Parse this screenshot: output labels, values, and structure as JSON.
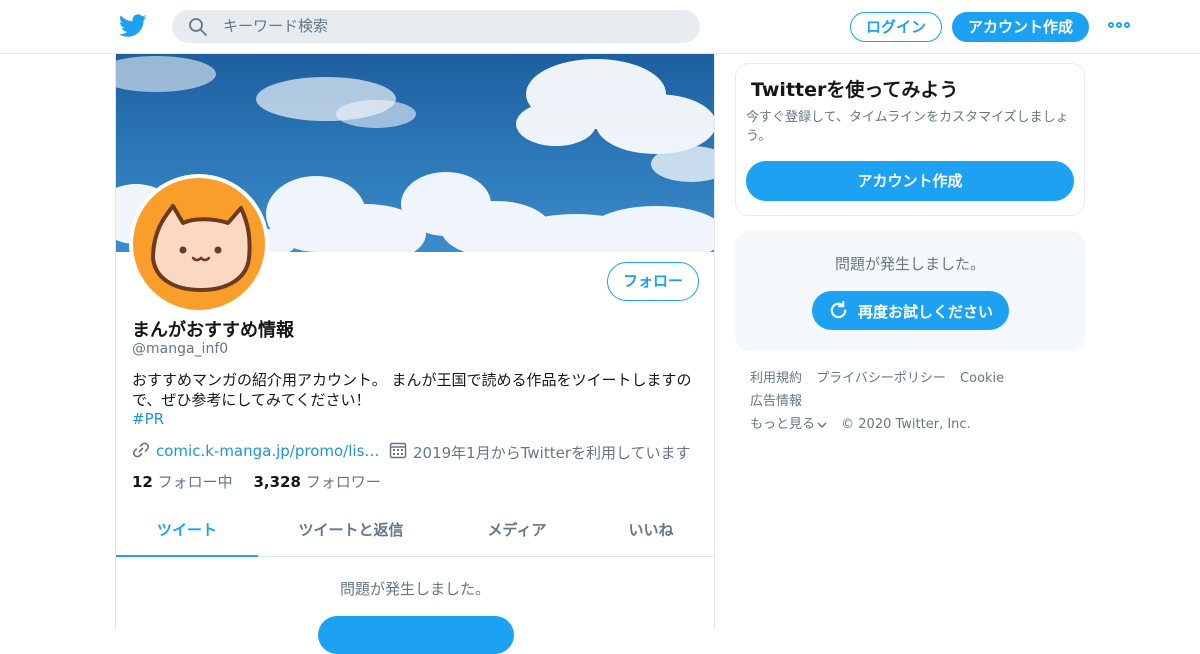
{
  "topbar": {
    "search_placeholder": "キーワード検索",
    "login_label": "ログイン",
    "signup_label": "アカウント作成"
  },
  "profile": {
    "name": "まんがおすすめ情報",
    "handle": "@manga_inf0",
    "follow_label": "フォロー",
    "bio": "おすすめマンガの紹介用アカウント。 まんが王国で読める作品をツイートしますので、ぜひ参考にしてみてください！",
    "hashtag": "#PR",
    "url": "comic.k-manga.jp/promo/listing/…",
    "joined": "2019年1月からTwitterを利用しています",
    "following_count": "12",
    "following_label": "フォロー中",
    "followers_count": "3,328",
    "followers_label": "フォロワー"
  },
  "tabs": [
    {
      "label": "ツイート",
      "active": true
    },
    {
      "label": "ツイートと返信",
      "active": false
    },
    {
      "label": "メディア",
      "active": false
    },
    {
      "label": "いいね",
      "active": false
    }
  ],
  "timeline": {
    "error_message": "問題が発生しました。"
  },
  "sidebar": {
    "card_title": "Twitterを使ってみよう",
    "card_text": "今すぐ登録して、タイムラインをカスタマイズしましょう。",
    "card_button": "アカウント作成",
    "error_message": "問題が発生しました。",
    "retry_label": "再度お試しください"
  },
  "footer": {
    "links": [
      "利用規約",
      "プライバシーポリシー",
      "Cookie",
      "広告情報",
      "もっと見る"
    ],
    "copyright": "© 2020 Twitter, Inc."
  },
  "colors": {
    "accent": "#1da1f2",
    "link": "#1b95e0",
    "secondary_text": "#657786",
    "avatar_bg": "#f99d2b"
  },
  "icons": [
    "twitter-bird-icon",
    "search-icon",
    "more-icon",
    "link-icon",
    "calendar-icon",
    "refresh-icon",
    "chevron-down-icon"
  ]
}
